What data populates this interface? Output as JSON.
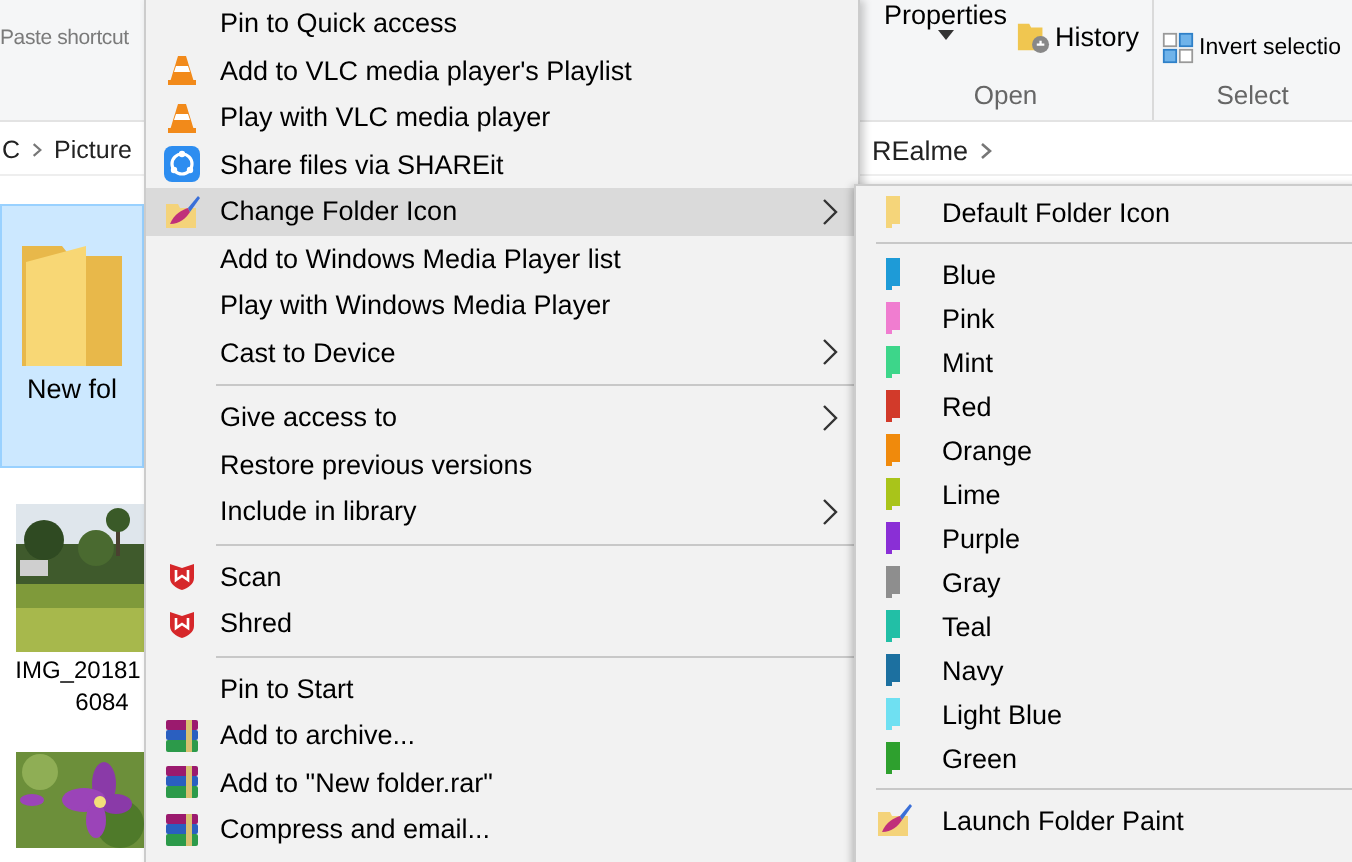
{
  "ribbon": {
    "paste_shortcut": "Paste shortcut",
    "properties": "Properties",
    "history": "History",
    "open_group": "Open",
    "invert_selection": "Invert selectio",
    "select_group": "Select"
  },
  "address_bar": {
    "left_crumbs": [
      "C",
      "Picture"
    ],
    "right_crumbs": [
      "REalme"
    ]
  },
  "files": [
    {
      "kind": "folder",
      "label": "New fol",
      "selected": true
    },
    {
      "kind": "landscape",
      "lines": [
        "IMG_20181",
        "6084"
      ]
    },
    {
      "kind": "flower"
    }
  ],
  "context_menu": {
    "items": [
      {
        "kind": "plain",
        "label": "Pin to Quick access",
        "selected": false,
        "submenu": false
      },
      {
        "kind": "vlc",
        "label": "Add to VLC media player's Playlist",
        "selected": false,
        "submenu": false
      },
      {
        "kind": "vlc",
        "label": "Play with VLC media player",
        "selected": false,
        "submenu": false
      },
      {
        "kind": "shareit",
        "label": "Share files via SHAREit",
        "selected": false,
        "submenu": false
      },
      {
        "kind": "painter",
        "label": "Change Folder Icon",
        "selected": true,
        "submenu": true
      },
      {
        "kind": "plain",
        "label": "Add to Windows Media Player list",
        "selected": false,
        "submenu": false
      },
      {
        "kind": "plain",
        "label": "Play with Windows Media Player",
        "selected": false,
        "submenu": false
      },
      {
        "kind": "plain",
        "label": "Cast to Device",
        "selected": false,
        "submenu": true
      },
      {
        "kind": "separator"
      },
      {
        "kind": "plain",
        "label": "Give access to",
        "selected": false,
        "submenu": true
      },
      {
        "kind": "plain",
        "label": "Restore previous versions",
        "selected": false,
        "submenu": false
      },
      {
        "kind": "plain",
        "label": "Include in library",
        "selected": false,
        "submenu": true
      },
      {
        "kind": "separator"
      },
      {
        "kind": "shield",
        "label": "Scan",
        "selected": false,
        "submenu": false
      },
      {
        "kind": "shield",
        "label": "Shred",
        "selected": false,
        "submenu": false
      },
      {
        "kind": "separator"
      },
      {
        "kind": "plain",
        "label": "Pin to Start",
        "selected": false,
        "submenu": false
      },
      {
        "kind": "archive",
        "label": "Add to archive...",
        "selected": false,
        "submenu": false
      },
      {
        "kind": "archive",
        "label": "Add to \"New folder.rar\"",
        "selected": false,
        "submenu": false
      },
      {
        "kind": "archive",
        "label": "Compress and email...",
        "selected": false,
        "submenu": false
      }
    ]
  },
  "submenu": {
    "items": [
      {
        "kind": "color",
        "label": "Default Folder Icon",
        "color": "#f5d57a"
      },
      {
        "kind": "separator"
      },
      {
        "kind": "color",
        "label": "Blue",
        "color": "#1e9bd7"
      },
      {
        "kind": "color",
        "label": "Pink",
        "color": "#f07dd0"
      },
      {
        "kind": "color",
        "label": "Mint",
        "color": "#3dd68a"
      },
      {
        "kind": "color",
        "label": "Red",
        "color": "#d23a2a"
      },
      {
        "kind": "color",
        "label": "Orange",
        "color": "#f08a0c"
      },
      {
        "kind": "color",
        "label": "Lime",
        "color": "#a9c41a"
      },
      {
        "kind": "color",
        "label": "Purple",
        "color": "#8a2fd6"
      },
      {
        "kind": "color",
        "label": "Gray",
        "color": "#8e8e8e"
      },
      {
        "kind": "color",
        "label": "Teal",
        "color": "#22bfa6"
      },
      {
        "kind": "color",
        "label": "Navy",
        "color": "#1c70a0"
      },
      {
        "kind": "color",
        "label": "Light Blue",
        "color": "#6fe0f2"
      },
      {
        "kind": "color",
        "label": "Green",
        "color": "#2ea02e"
      },
      {
        "kind": "separator"
      },
      {
        "kind": "painter",
        "label": "Launch Folder Paint"
      }
    ]
  }
}
